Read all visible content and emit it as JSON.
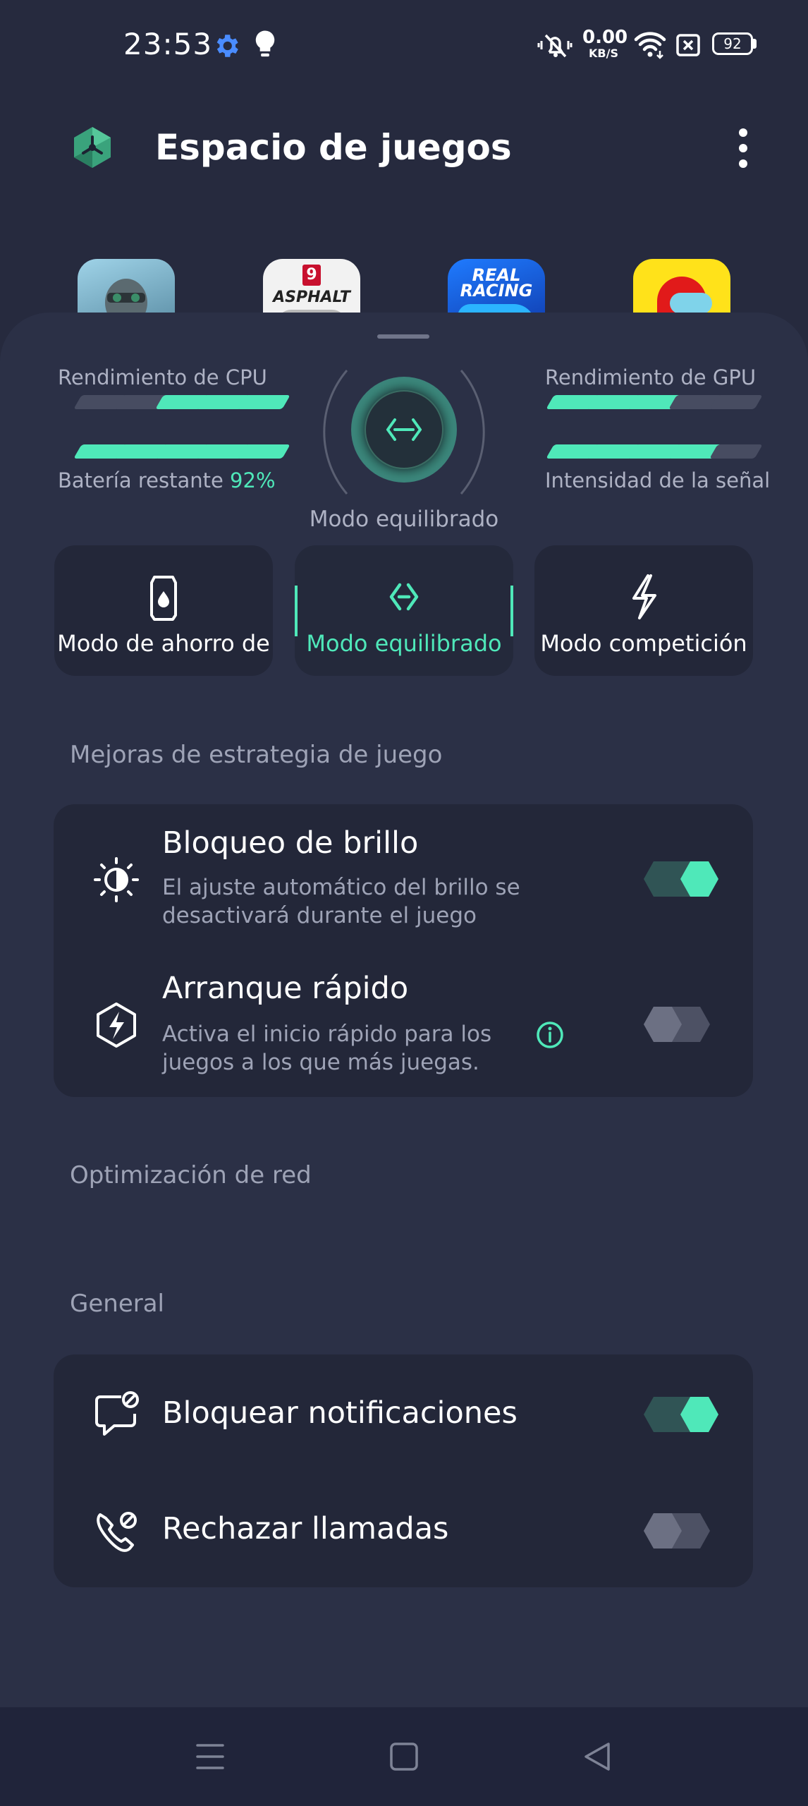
{
  "status": {
    "time": "23:53",
    "net_speed_value": "0.00",
    "net_speed_unit": "KB/S",
    "battery": "92",
    "icons": [
      "settings-gear-icon",
      "bulb-icon",
      "mute-vibrate-icon",
      "wifi-icon",
      "sim-icon",
      "battery-icon"
    ]
  },
  "header": {
    "title": "Espacio de juegos",
    "logo_icon": "game-space-logo-icon",
    "menu_icon": "more-vert-icon"
  },
  "games": [
    {
      "name": "call-of-duty",
      "label": ""
    },
    {
      "name": "asphalt-9",
      "label": "ASPHALT",
      "badge": "9"
    },
    {
      "name": "real-racing",
      "label": "REAL RACING"
    },
    {
      "name": "among-us",
      "label": ""
    }
  ],
  "performance": {
    "cpu_label": "Rendimiento de CPU",
    "gpu_label": "Rendimiento de GPU",
    "battery_label": "Batería restante",
    "battery_value": "92%",
    "signal_label": "Intensidad de la señal",
    "cpu_level": 3,
    "gpu_level": 3,
    "battery_level": 5,
    "signal_level": 4,
    "max_level": 5,
    "current_mode": "Modo equilibrado"
  },
  "modes": [
    {
      "label": "Modo de ahorro de",
      "icon": "battery-saver-icon",
      "active": false
    },
    {
      "label": "Modo equilibrado",
      "icon": "balanced-mode-icon",
      "active": true
    },
    {
      "label": "Modo competición",
      "icon": "lightning-icon",
      "active": false
    }
  ],
  "strategy": {
    "section_title": "Mejoras de estrategia de juego",
    "items": [
      {
        "title": "Bloqueo de brillo",
        "desc": "El ajuste automático del brillo se desactivará durante el juego",
        "icon": "brightness-icon",
        "enabled": true
      },
      {
        "title": "Arranque rápido",
        "desc": "Activa el inicio rápido para los juegos a los que más juegas.",
        "icon": "quick-start-icon",
        "enabled": false
      }
    ]
  },
  "network": {
    "section_title": "Optimización de red"
  },
  "general": {
    "section_title": "General",
    "items": [
      {
        "title": "Bloquear notificaciones",
        "icon": "block-notifications-icon",
        "enabled": true
      },
      {
        "title": "Rechazar llamadas",
        "icon": "reject-calls-icon",
        "enabled": false
      }
    ]
  },
  "colors": {
    "accent": "#4fe8b9",
    "background": "#262a3e",
    "card": "#232739"
  }
}
